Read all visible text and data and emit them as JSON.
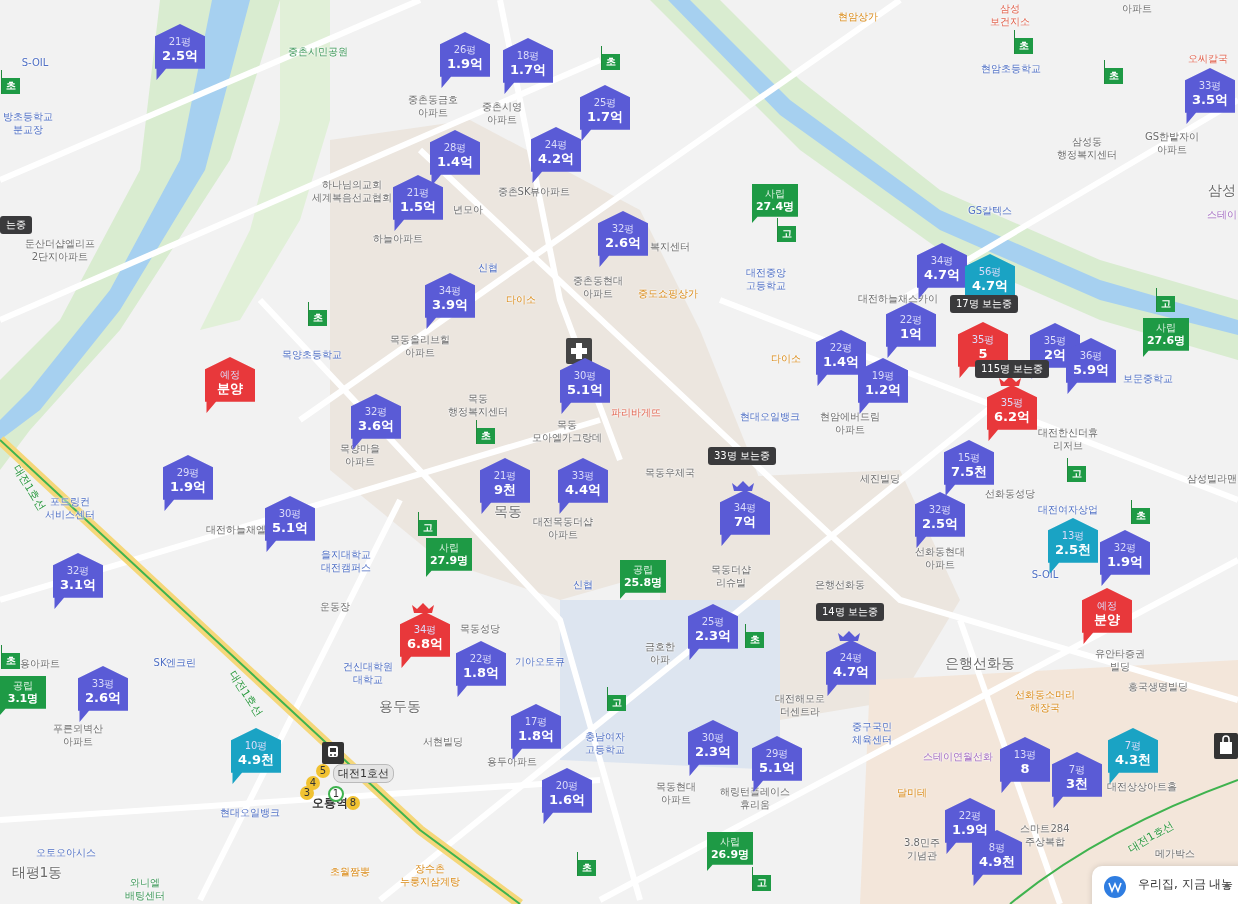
{
  "markers": [
    {
      "size": "21평",
      "price": "2.5억",
      "color": "#5a5bd6",
      "crown": false
    },
    {
      "size": "26평",
      "price": "1.9억",
      "color": "#5a5bd6",
      "crown": false
    },
    {
      "size": "18평",
      "price": "1.7억",
      "color": "#5a5bd6",
      "crown": false
    },
    {
      "size": "25평",
      "price": "1.7억",
      "color": "#5a5bd6",
      "crown": false
    },
    {
      "size": "28평",
      "price": "1.4억",
      "color": "#5a5bd6",
      "crown": false
    },
    {
      "size": "24평",
      "price": "4.2억",
      "color": "#5a5bd6",
      "crown": false
    },
    {
      "size": "21평",
      "price": "1.5억",
      "color": "#5a5bd6",
      "crown": false
    },
    {
      "size": "32평",
      "price": "2.6억",
      "color": "#5a5bd6",
      "crown": false
    },
    {
      "size": "34평",
      "price": "3.9억",
      "color": "#5a5bd6",
      "crown": false
    },
    {
      "size": "예정",
      "price": "분양",
      "color": "#e8383b",
      "crown": false
    },
    {
      "size": "30평",
      "price": "5.1억",
      "color": "#5a5bd6",
      "crown": false
    },
    {
      "size": "32평",
      "price": "3.6억",
      "color": "#5a5bd6",
      "crown": false
    },
    {
      "size": "29평",
      "price": "1.9억",
      "color": "#5a5bd6",
      "crown": false
    },
    {
      "size": "30평",
      "price": "5.1억",
      "color": "#5a5bd6",
      "crown": false
    },
    {
      "size": "32평",
      "price": "3.1억",
      "color": "#5a5bd6",
      "crown": false
    },
    {
      "size": "33평",
      "price": "2.6억",
      "color": "#5a5bd6",
      "crown": false
    },
    {
      "size": "10평",
      "price": "4.9천",
      "color": "#1aa3c4",
      "crown": false
    },
    {
      "size": "21평",
      "price": "9천",
      "color": "#5a5bd6",
      "crown": false
    },
    {
      "size": "33평",
      "price": "4.4억",
      "color": "#5a5bd6",
      "crown": false
    },
    {
      "size": "34평",
      "price": "7억",
      "color": "#5a5bd6",
      "crown": true
    },
    {
      "size": "34평",
      "price": "6.8억",
      "color": "#e8383b",
      "crown": true
    },
    {
      "size": "22평",
      "price": "1.8억",
      "color": "#5a5bd6",
      "crown": false
    },
    {
      "size": "25평",
      "price": "2.3억",
      "color": "#5a5bd6",
      "crown": false
    },
    {
      "size": "17평",
      "price": "1.8억",
      "color": "#5a5bd6",
      "crown": false
    },
    {
      "size": "20평",
      "price": "1.6억",
      "color": "#5a5bd6",
      "crown": false
    },
    {
      "size": "30평",
      "price": "2.3억",
      "color": "#5a5bd6",
      "crown": false
    },
    {
      "size": "29평",
      "price": "5.1억",
      "color": "#5a5bd6",
      "crown": false
    },
    {
      "size": "24평",
      "price": "4.7억",
      "color": "#5a5bd6",
      "crown": true
    },
    {
      "size": "32평",
      "price": "2.5억",
      "color": "#5a5bd6",
      "crown": false
    },
    {
      "size": "15평",
      "price": "7.5천",
      "color": "#5a5bd6",
      "crown": false
    },
    {
      "size": "34평",
      "price": "4.7억",
      "color": "#5a5bd6",
      "crown": false
    },
    {
      "size": "56평",
      "price": "4.7억",
      "color": "#1aa3c4",
      "crown": false
    },
    {
      "size": "22평",
      "price": "1억",
      "color": "#5a5bd6",
      "crown": false
    },
    {
      "size": "22평",
      "price": "1.4억",
      "color": "#5a5bd6",
      "crown": false
    },
    {
      "size": "19평",
      "price": "1.2억",
      "color": "#5a5bd6",
      "crown": false
    },
    {
      "size": "35평",
      "price": "5",
      "color": "#e8383b",
      "crown": false
    },
    {
      "size": "35평",
      "price": "2억",
      "color": "#5a5bd6",
      "crown": false
    },
    {
      "size": "36평",
      "price": "5.9억",
      "color": "#5a5bd6",
      "crown": false
    },
    {
      "size": "35평",
      "price": "6.2억",
      "color": "#e8383b",
      "crown": true
    },
    {
      "size": "33평",
      "price": "3.5억",
      "color": "#5a5bd6",
      "crown": false
    },
    {
      "size": "13평",
      "price": "2.5천",
      "color": "#1aa3c4",
      "crown": false
    },
    {
      "size": "32평",
      "price": "1.9억",
      "color": "#5a5bd6",
      "crown": false
    },
    {
      "size": "예정",
      "price": "분양",
      "color": "#e8383b",
      "crown": false
    },
    {
      "size": "13평",
      "price": "8",
      "color": "#5a5bd6",
      "crown": false
    },
    {
      "size": "7평",
      "price": "3천",
      "color": "#5a5bd6",
      "crown": false
    },
    {
      "size": "7평",
      "price": "4.3천",
      "color": "#1aa3c4",
      "crown": false
    },
    {
      "size": "22평",
      "price": "1.9억",
      "color": "#5a5bd6",
      "crown": false
    },
    {
      "size": "8평",
      "price": "4.9천",
      "color": "#5a5bd6",
      "crown": false
    }
  ],
  "viewer_tags": [
    {
      "text": "33명 보는중"
    },
    {
      "text": "14명 보는중"
    },
    {
      "text": "17명 보는중"
    },
    {
      "text": "115명 보는중"
    },
    {
      "text": "는중"
    }
  ],
  "school_flags": [
    {
      "label": "초"
    },
    {
      "label": "초"
    },
    {
      "label": "초"
    },
    {
      "label": "초"
    },
    {
      "label": "초"
    },
    {
      "label": "초"
    },
    {
      "label": "고"
    },
    {
      "label": "초"
    },
    {
      "label": "고"
    },
    {
      "label": "고"
    },
    {
      "label": "초"
    },
    {
      "label": "초"
    },
    {
      "label": "고"
    },
    {
      "label": "초"
    },
    {
      "label": "고"
    },
    {
      "label": "고"
    }
  ],
  "school_stats": [
    {
      "type": "사립",
      "value": "27.4명"
    },
    {
      "type": "사립",
      "value": "27.6명"
    },
    {
      "type": "사립",
      "value": "27.9명"
    },
    {
      "type": "공립",
      "value": "25.8명"
    },
    {
      "type": "공립",
      "value": "3.1명"
    },
    {
      "type": "사립",
      "value": "26.9명"
    }
  ],
  "places": [
    {
      "kind": "facility",
      "lines": [
        "S-OIL"
      ]
    },
    {
      "kind": "park",
      "lines": [
        "중촌시민공원"
      ]
    },
    {
      "kind": "facility",
      "lines": [
        "방초등학교",
        "분교장"
      ]
    },
    {
      "kind": "building",
      "lines": [
        "하나님의교회",
        "세계복음선교협회"
      ]
    },
    {
      "kind": "building",
      "lines": [
        "둔산더샵엘리프",
        "2단지아파트"
      ]
    },
    {
      "kind": "building",
      "lines": [
        "하늘아파트"
      ]
    },
    {
      "kind": "building",
      "lines": [
        "년모아"
      ]
    },
    {
      "kind": "building",
      "lines": [
        "중촌동금호",
        "아파트"
      ]
    },
    {
      "kind": "building",
      "lines": [
        "중촌시영",
        "아파트"
      ]
    },
    {
      "kind": "building",
      "lines": [
        "중촌SK뷰아파트"
      ]
    },
    {
      "kind": "building",
      "lines": [
        "복지센터"
      ]
    },
    {
      "kind": "facility",
      "lines": [
        "신협"
      ]
    },
    {
      "kind": "shop",
      "lines": [
        "다이소"
      ]
    },
    {
      "kind": "building",
      "lines": [
        "중촌동현대",
        "아파트"
      ]
    },
    {
      "kind": "shop",
      "lines": [
        "중도쇼핑상가"
      ]
    },
    {
      "kind": "facility",
      "lines": [
        "대전중앙",
        "고등학교"
      ]
    },
    {
      "kind": "building",
      "lines": [
        "목동올리브힐",
        "아파트"
      ]
    },
    {
      "kind": "building",
      "lines": [
        "목동",
        "행정복지센터"
      ]
    },
    {
      "kind": "building",
      "lines": [
        "목동",
        "모아엘가그랑데"
      ]
    },
    {
      "kind": "food",
      "lines": [
        "파리바게뜨"
      ]
    },
    {
      "kind": "shop",
      "lines": [
        "다이소"
      ]
    },
    {
      "kind": "facility",
      "lines": [
        "현대오일뱅크"
      ]
    },
    {
      "kind": "building",
      "lines": [
        "목동우체국"
      ]
    },
    {
      "kind": "building",
      "lines": [
        "현암에버드림",
        "아파트"
      ]
    },
    {
      "kind": "building",
      "lines": [
        "대전하늘채스카이"
      ]
    },
    {
      "kind": "facility",
      "lines": [
        "GS칼텍스"
      ]
    },
    {
      "kind": "building",
      "lines": [
        "삼성동",
        "행정복지센터"
      ]
    },
    {
      "kind": "building",
      "lines": [
        "GS한밭자이",
        "아파트"
      ]
    },
    {
      "kind": "facility",
      "lines": [
        "현암초등학교"
      ]
    },
    {
      "kind": "shop",
      "lines": [
        "현암상가"
      ]
    },
    {
      "kind": "food",
      "lines": [
        "삼성",
        "보건지소"
      ]
    },
    {
      "kind": "food",
      "lines": [
        "오씨칼국"
      ]
    },
    {
      "kind": "building",
      "lines": [
        "아파트"
      ]
    },
    {
      "kind": "district",
      "lines": [
        "삼성"
      ]
    },
    {
      "kind": "leisure",
      "lines": [
        "스테이"
      ]
    },
    {
      "kind": "facility",
      "lines": [
        "보문중학교"
      ]
    },
    {
      "kind": "building",
      "lines": [
        "대전한신더휴",
        "리저브"
      ]
    },
    {
      "kind": "building",
      "lines": [
        "세진빌딩"
      ]
    },
    {
      "kind": "building",
      "lines": [
        "선화동성당"
      ]
    },
    {
      "kind": "facility",
      "lines": [
        "대전여자상업"
      ]
    },
    {
      "kind": "facility",
      "lines": [
        "S-OIL"
      ]
    },
    {
      "kind": "building",
      "lines": [
        "선화동현대",
        "아파트"
      ]
    },
    {
      "kind": "building",
      "lines": [
        "삼성빌라맨"
      ]
    },
    {
      "kind": "district",
      "lines": [
        "은행선화동"
      ]
    },
    {
      "kind": "building",
      "lines": [
        "유안타증권",
        "빌딩"
      ]
    },
    {
      "kind": "shop",
      "lines": [
        "선화동소머리",
        "해장국"
      ]
    },
    {
      "kind": "building",
      "lines": [
        "흥국생명빌딩"
      ]
    },
    {
      "kind": "facility",
      "lines": [
        "중구국민",
        "체육센터"
      ]
    },
    {
      "kind": "leisure",
      "lines": [
        "스테이연월선화"
      ]
    },
    {
      "kind": "shop",
      "lines": [
        "달미테"
      ]
    },
    {
      "kind": "building",
      "lines": [
        "3.8민주",
        "기념관"
      ]
    },
    {
      "kind": "building",
      "lines": [
        "스마트284",
        "주상복합"
      ]
    },
    {
      "kind": "building",
      "lines": [
        "대전상상아트홀"
      ]
    },
    {
      "kind": "building",
      "lines": [
        "메가박스"
      ]
    },
    {
      "kind": "building",
      "lines": [
        "목동더샵",
        "리슈빌"
      ]
    },
    {
      "kind": "building",
      "lines": [
        "은행선화동"
      ]
    },
    {
      "kind": "building",
      "lines": [
        "금호한",
        "아파"
      ]
    },
    {
      "kind": "building",
      "lines": [
        "대전해모로",
        "더센트라"
      ]
    },
    {
      "kind": "building",
      "lines": [
        "목동현대",
        "아파트"
      ]
    },
    {
      "kind": "building",
      "lines": [
        "해링턴플레이스",
        "휴리움"
      ]
    },
    {
      "kind": "facility",
      "lines": [
        "충남여자",
        "고등학교"
      ]
    },
    {
      "kind": "building",
      "lines": [
        "용두아파트"
      ]
    },
    {
      "kind": "building",
      "lines": [
        "서현빌딩"
      ]
    },
    {
      "kind": "facility",
      "lines": [
        "기아오토큐"
      ]
    },
    {
      "kind": "building",
      "lines": [
        "목동성당"
      ]
    },
    {
      "kind": "building",
      "lines": [
        "대전목동더샵",
        "아파트"
      ]
    },
    {
      "kind": "facility",
      "lines": [
        "신협"
      ]
    },
    {
      "kind": "district",
      "lines": [
        "목동"
      ]
    },
    {
      "kind": "building",
      "lines": [
        "목양마을",
        "아파트"
      ]
    },
    {
      "kind": "facility",
      "lines": [
        "목양초등학교"
      ]
    },
    {
      "kind": "building",
      "lines": [
        "대전하늘채엘"
      ]
    },
    {
      "kind": "facility",
      "lines": [
        "을지대학교",
        "대전캠퍼스"
      ]
    },
    {
      "kind": "building",
      "lines": [
        "운동장"
      ]
    },
    {
      "kind": "facility",
      "lines": [
        "건신대학원",
        "대학교"
      ]
    },
    {
      "kind": "district",
      "lines": [
        "용두동"
      ]
    },
    {
      "kind": "facility",
      "lines": [
        "포드링컨",
        "서비스센터"
      ]
    },
    {
      "kind": "building",
      "lines": [
        "용아파트"
      ]
    },
    {
      "kind": "facility",
      "lines": [
        "SK엔크린"
      ]
    },
    {
      "kind": "building",
      "lines": [
        "푸른뫼벽산",
        "아파트"
      ]
    },
    {
      "kind": "facility",
      "lines": [
        "현대오일뱅크"
      ]
    },
    {
      "kind": "station",
      "lines": [
        "오룡역"
      ]
    },
    {
      "kind": "facility",
      "lines": [
        "오토오아시스"
      ]
    },
    {
      "kind": "district",
      "lines": [
        "태평1동"
      ]
    },
    {
      "kind": "park",
      "lines": [
        "와니엘",
        "배팅센터"
      ]
    },
    {
      "kind": "shop",
      "lines": [
        "초월짬뽕"
      ]
    },
    {
      "kind": "shop",
      "lines": [
        "장수촌",
        "누룽지삼계탕"
      ]
    }
  ],
  "line_labels": [
    {
      "text": "대전1호선"
    },
    {
      "text": "대전1호선"
    },
    {
      "text": "대전1호선"
    }
  ],
  "station": {
    "line": "대전1호선",
    "exits": [
      "5",
      "4",
      "3",
      "1",
      "8"
    ]
  },
  "promo_card": {
    "text": "우리집, 지금 내놓"
  }
}
